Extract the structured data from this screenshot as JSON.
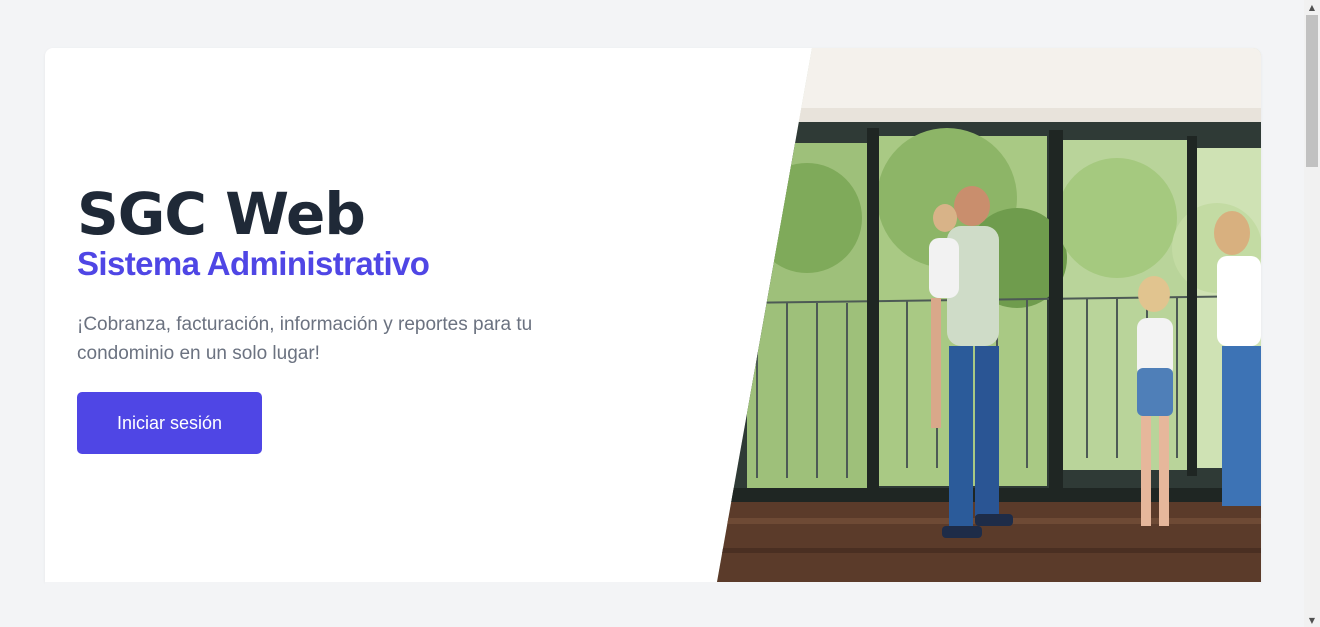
{
  "hero": {
    "title": "SGC Web",
    "subtitle": "Sistema Administrativo",
    "description": "¡Cobranza, facturación, información y reportes para tu condominio en un solo lugar!",
    "login_button_label": "Iniciar sesión"
  },
  "photo": {
    "subject": "family-in-apartment-photo"
  },
  "scrollbar": {
    "up_icon": "triangle-up-icon",
    "down_icon": "triangle-down-icon"
  },
  "colors": {
    "accent": "#4f46e5",
    "title": "#1f2937",
    "text_muted": "#6b7280",
    "page_bg": "#f3f4f6"
  }
}
